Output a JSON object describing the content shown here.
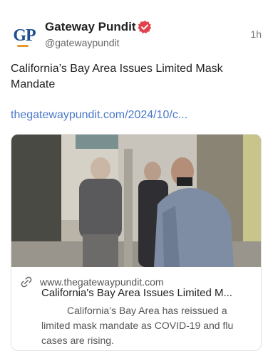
{
  "author": {
    "avatar_text": "GP",
    "name": "Gateway Pundit",
    "handle": "@gatewaypundit",
    "time": "1h"
  },
  "post": {
    "text": "California’s Bay Area Issues Limited Mask Mandate",
    "link": "thegatewaypundit.com/2024/10/c..."
  },
  "card": {
    "domain": "www.thegatewaypundit.com",
    "title": "California's Bay Area Issues Limited M...",
    "description": "California’s Bay Area has reissued a limited mask mandate as COVID-19 and flu cases are rising."
  },
  "colors": {
    "brand_blue": "#1f4f8c",
    "brand_orange": "#e19b2b",
    "verified_red": "#e0414a",
    "link_blue": "#4a78c9"
  }
}
